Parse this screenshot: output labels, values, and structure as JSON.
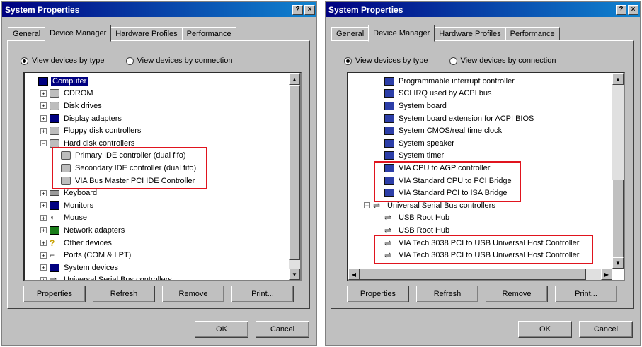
{
  "left": {
    "title": "System Properties",
    "title_buttons": [
      "?",
      "×"
    ],
    "tabs": [
      "General",
      "Device Manager",
      "Hardware Profiles",
      "Performance"
    ],
    "radio_type": "View devices by type",
    "radio_connection": "View devices by connection",
    "tree": [
      {
        "label": "Computer",
        "icon": "monitor-icon",
        "indent": 0,
        "expander": "",
        "selected": true
      },
      {
        "label": "CDROM",
        "icon": "drive-icon",
        "indent": 1,
        "expander": "+"
      },
      {
        "label": "Disk drives",
        "icon": "drive-icon",
        "indent": 1,
        "expander": "+"
      },
      {
        "label": "Display adapters",
        "icon": "monitor-icon",
        "indent": 1,
        "expander": "+"
      },
      {
        "label": "Floppy disk controllers",
        "icon": "drive-icon",
        "indent": 1,
        "expander": "+"
      },
      {
        "label": "Hard disk controllers",
        "icon": "drive-icon",
        "indent": 1,
        "expander": "−"
      },
      {
        "label": "Primary IDE controller (dual fifo)",
        "icon": "drive-icon",
        "indent": 2,
        "expander": ""
      },
      {
        "label": "Secondary IDE controller (dual fifo)",
        "icon": "drive-icon",
        "indent": 2,
        "expander": ""
      },
      {
        "label": "VIA Bus Master PCI IDE Controller",
        "icon": "drive-icon",
        "indent": 2,
        "expander": ""
      },
      {
        "label": "Keyboard",
        "icon": "keyboard-icon",
        "indent": 1,
        "expander": "+"
      },
      {
        "label": "Monitors",
        "icon": "monitor-icon",
        "indent": 1,
        "expander": "+"
      },
      {
        "label": "Mouse",
        "icon": "mouse-icon",
        "indent": 1,
        "expander": "+"
      },
      {
        "label": "Network adapters",
        "icon": "network-icon",
        "indent": 1,
        "expander": "+"
      },
      {
        "label": "Other devices",
        "icon": "question-icon",
        "indent": 1,
        "expander": "+"
      },
      {
        "label": "Ports (COM & LPT)",
        "icon": "port-icon",
        "indent": 1,
        "expander": "+"
      },
      {
        "label": "System devices",
        "icon": "monitor-icon",
        "indent": 1,
        "expander": "+"
      },
      {
        "label": "Universal Serial Bus controllers",
        "icon": "usb-icon",
        "indent": 1,
        "expander": "+"
      }
    ],
    "buttons": [
      "Properties",
      "Refresh",
      "Remove",
      "Print..."
    ],
    "ok": "OK",
    "cancel": "Cancel"
  },
  "right": {
    "title": "System Properties",
    "title_buttons": [
      "?",
      "×"
    ],
    "tabs": [
      "General",
      "Device Manager",
      "Hardware Profiles",
      "Performance"
    ],
    "radio_type": "View devices by type",
    "radio_connection": "View devices by connection",
    "tree": [
      {
        "label": "Programmable interrupt controller",
        "icon": "chip-icon",
        "indent": 2,
        "expander": ""
      },
      {
        "label": "SCI IRQ used by ACPI bus",
        "icon": "chip-icon",
        "indent": 2,
        "expander": ""
      },
      {
        "label": "System board",
        "icon": "chip-icon",
        "indent": 2,
        "expander": ""
      },
      {
        "label": "System board extension for ACPI BIOS",
        "icon": "chip-icon",
        "indent": 2,
        "expander": ""
      },
      {
        "label": "System CMOS/real time clock",
        "icon": "chip-icon",
        "indent": 2,
        "expander": ""
      },
      {
        "label": "System speaker",
        "icon": "chip-icon",
        "indent": 2,
        "expander": ""
      },
      {
        "label": "System timer",
        "icon": "chip-icon",
        "indent": 2,
        "expander": ""
      },
      {
        "label": "VIA CPU to AGP controller",
        "icon": "chip-icon",
        "indent": 2,
        "expander": ""
      },
      {
        "label": "VIA Standard CPU to PCI Bridge",
        "icon": "chip-icon",
        "indent": 2,
        "expander": ""
      },
      {
        "label": "VIA Standard PCI to ISA Bridge",
        "icon": "chip-icon",
        "indent": 2,
        "expander": ""
      },
      {
        "label": "Universal Serial Bus controllers",
        "icon": "usb-icon",
        "indent": 1,
        "expander": "−"
      },
      {
        "label": "USB Root Hub",
        "icon": "usb-icon",
        "indent": 2,
        "expander": ""
      },
      {
        "label": "USB Root Hub",
        "icon": "usb-icon",
        "indent": 2,
        "expander": ""
      },
      {
        "label": "VIA Tech 3038 PCI to USB Universal Host Controller",
        "icon": "usb-icon",
        "indent": 2,
        "expander": ""
      },
      {
        "label": "VIA Tech 3038 PCI to USB Universal Host Controller",
        "icon": "usb-icon",
        "indent": 2,
        "expander": ""
      }
    ],
    "buttons": [
      "Properties",
      "Refresh",
      "Remove",
      "Print..."
    ],
    "ok": "OK",
    "cancel": "Cancel"
  },
  "colors": {
    "highlight": "#e0141e",
    "titlebar": "#000080",
    "face": "#c0c0c0"
  }
}
